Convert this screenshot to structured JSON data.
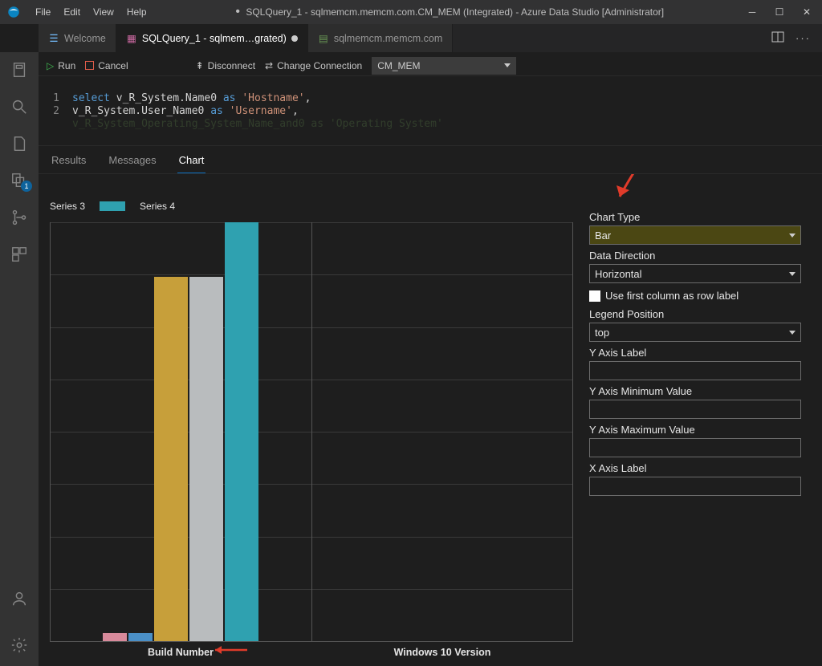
{
  "titlebar": {
    "menus": {
      "file": "File",
      "edit": "Edit",
      "view": "View",
      "help": "Help"
    },
    "title": "SQLQuery_1 - sqlmemcm.memcm.com.CM_MEM (Integrated) - Azure Data Studio [Administrator]"
  },
  "tabs": {
    "welcome": "Welcome",
    "active": "SQLQuery_1 - sqlmem…grated)",
    "inactive": "sqlmemcm.memcm.com"
  },
  "activitybar": {
    "badge_count": "1"
  },
  "run_toolbar": {
    "run": "Run",
    "cancel": "Cancel",
    "disconnect": "Disconnect",
    "change_conn": "Change Connection",
    "db_selected": "CM_MEM"
  },
  "code": {
    "line1_a": "select",
    "line1_b": " v_R_System.Name0 ",
    "line1_c": "as",
    "line1_d": " ",
    "line1_e": "'Hostname'",
    "line1_f": ",",
    "line2_a": "v_R_System.User_Name0 ",
    "line2_b": "as",
    "line2_c": " ",
    "line2_d": "'Username'",
    "line2_e": ",",
    "line3_cut": "v_R_System_Operating_System_Name_and0 as 'Operating System'"
  },
  "results_tabs": {
    "results": "Results",
    "messages": "Messages",
    "chart": "Chart"
  },
  "legend": {
    "s3": "Series 3",
    "s4": "Series 4"
  },
  "xlabels": {
    "a": "Build Number",
    "b": "Windows 10 Version"
  },
  "options": {
    "chart_type_label": "Chart Type",
    "chart_type_value": "Bar",
    "data_direction_label": "Data Direction",
    "data_direction_value": "Horizontal",
    "row_label_checkbox": "Use first column as row label",
    "legend_position_label": "Legend Position",
    "legend_position_value": "top",
    "y_label": "Y Axis Label",
    "y_min": "Y Axis Minimum Value",
    "y_max": "Y Axis Maximum Value",
    "x_label": "X Axis Label"
  },
  "colors": {
    "s3": "#2fa1b0",
    "s4": "#c79f3a",
    "extra_grey": "#b9bcbe",
    "extra_pink": "#d88a9b",
    "extra_blue": "#4a8fc6"
  },
  "chart_data": {
    "type": "bar",
    "categories": [
      "Build Number",
      "Windows 10 Version"
    ],
    "series": [
      {
        "name": "extra-pink",
        "values": [
          2,
          0
        ]
      },
      {
        "name": "extra-blue",
        "values": [
          2,
          0
        ]
      },
      {
        "name": "Series 4",
        "values": [
          87,
          0
        ]
      },
      {
        "name": "extra-grey",
        "values": [
          87,
          0
        ]
      },
      {
        "name": "Series 3",
        "values": [
          100,
          0
        ]
      }
    ],
    "legend_position": "top",
    "xlabel": "",
    "ylabel": "",
    "ylim": [
      0,
      100
    ]
  }
}
